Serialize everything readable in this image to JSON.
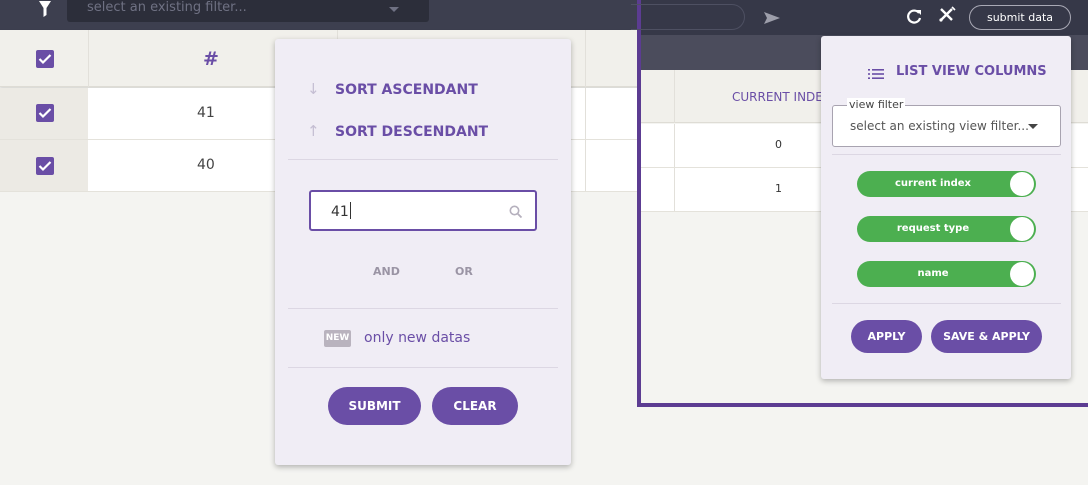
{
  "filter_bar": {
    "placeholder": "select an existing filter..."
  },
  "table": {
    "header_symbol": "#",
    "rows": [
      {
        "number": "41"
      },
      {
        "number": "40"
      }
    ]
  },
  "sort_popup": {
    "sort_ascendant": "SORT ASCENDANT",
    "sort_descendant": "SORT DESCENDANT",
    "search_value": "41",
    "and_label": "AND",
    "or_label": "OR",
    "new_badge": "NEW",
    "only_new_label": "only new datas",
    "submit_label": "SUBMIT",
    "clear_label": "CLEAR"
  },
  "right_toolbar": {
    "submit_data_label": "submit data"
  },
  "right_table": {
    "column_header": "CURRENT INDE",
    "rows": [
      {
        "index": "0"
      },
      {
        "index": "1"
      }
    ]
  },
  "columns_popup": {
    "title": "LIST VIEW COLUMNS",
    "view_filter_label": "view filter",
    "view_filter_placeholder": "select an existing view filter...",
    "toggles": [
      {
        "label": "current index",
        "on": true
      },
      {
        "label": "request type",
        "on": true
      },
      {
        "label": "name",
        "on": true
      }
    ],
    "apply_label": "APPLY",
    "save_apply_label": "SAVE & APPLY"
  },
  "colors": {
    "accent": "#6a4ea6",
    "toggle_on": "#4caf50",
    "dark_bar": "#363848"
  }
}
